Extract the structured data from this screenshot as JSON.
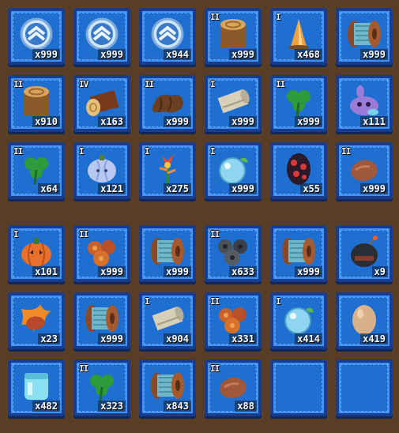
{
  "inventory": {
    "rows": [
      [
        {
          "item": "rank-badge-icon",
          "tier": "",
          "qty": "x999"
        },
        {
          "item": "rank-badge-icon",
          "tier": "",
          "qty": "x999"
        },
        {
          "item": "rank-badge-icon",
          "tier": "",
          "qty": "x944"
        },
        {
          "item": "tree-stump-icon",
          "tier": "II",
          "qty": "x999"
        },
        {
          "item": "crystal-shard-icon",
          "tier": "I",
          "qty": "x468"
        },
        {
          "item": "thread-spool-icon",
          "tier": "",
          "qty": "x999"
        }
      ],
      [
        {
          "item": "tree-stump-icon",
          "tier": "II",
          "qty": "x910"
        },
        {
          "item": "log-icon",
          "tier": "IV",
          "qty": "x163"
        },
        {
          "item": "leather-icon",
          "tier": "II",
          "qty": "x999"
        },
        {
          "item": "cloth-roll-icon",
          "tier": "I",
          "qty": "x999"
        },
        {
          "item": "clover-icon",
          "tier": "II",
          "qty": "x999"
        },
        {
          "item": "purple-critter-icon",
          "tier": "",
          "qty": "x111"
        }
      ],
      [
        {
          "item": "clover-icon",
          "tier": "II",
          "qty": "x64"
        },
        {
          "item": "frost-pumpkin-icon",
          "tier": "I",
          "qty": "x121"
        },
        {
          "item": "fire-flower-icon",
          "tier": "I",
          "qty": "x275"
        },
        {
          "item": "water-orb-icon",
          "tier": "I",
          "qty": "x999"
        },
        {
          "item": "dragon-egg-icon",
          "tier": "",
          "qty": "x55"
        },
        {
          "item": "meat-chunk-icon",
          "tier": "II",
          "qty": "x999"
        }
      ],
      [
        {
          "item": "pumpkin-icon",
          "tier": "I",
          "qty": "x101"
        },
        {
          "item": "ore-cluster-icon",
          "tier": "II",
          "qty": "x999"
        },
        {
          "item": "thread-spool-icon",
          "tier": "",
          "qty": "x999"
        },
        {
          "item": "dark-ore-icon",
          "tier": "II",
          "qty": "x633"
        },
        {
          "item": "thread-spool-icon",
          "tier": "",
          "qty": "x999"
        },
        {
          "item": "bomb-icon",
          "tier": "",
          "qty": "x9"
        }
      ],
      [
        {
          "item": "flame-meat-icon",
          "tier": "",
          "qty": "x23"
        },
        {
          "item": "thread-spool-icon",
          "tier": "",
          "qty": "x999"
        },
        {
          "item": "cloth-roll-icon",
          "tier": "I",
          "qty": "x904"
        },
        {
          "item": "ore-cluster-icon",
          "tier": "II",
          "qty": "x331"
        },
        {
          "item": "water-orb-icon",
          "tier": "I",
          "qty": "x414"
        },
        {
          "item": "egg-icon",
          "tier": "",
          "qty": "x419"
        }
      ],
      [
        {
          "item": "ice-jar-icon",
          "tier": "",
          "qty": "x482"
        },
        {
          "item": "clover-icon",
          "tier": "II",
          "qty": "x323"
        },
        {
          "item": "thread-spool-icon",
          "tier": "",
          "qty": "x843"
        },
        {
          "item": "meat-chunk-icon",
          "tier": "II",
          "qty": "x88"
        },
        {
          "item": "empty-slot",
          "tier": "",
          "qty": ""
        },
        {
          "item": "empty-slot",
          "tier": "",
          "qty": ""
        }
      ]
    ]
  },
  "colors": {
    "slot_fill": "#1f6fd1",
    "slot_border": "#173d8c",
    "background": "#5a3d25"
  }
}
